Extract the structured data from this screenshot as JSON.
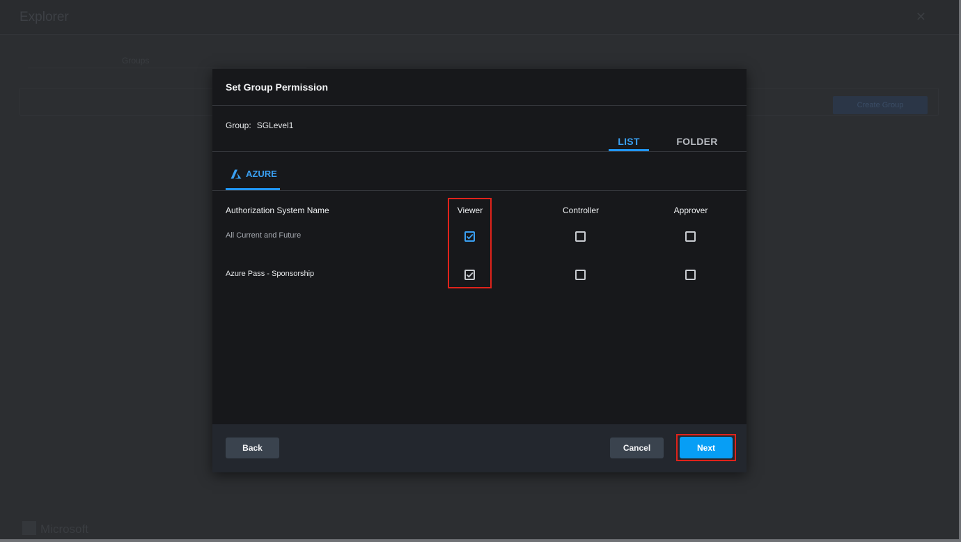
{
  "background": {
    "app_title": "Explorer",
    "tab_label": "Groups",
    "action_button": "Create Group",
    "footer_logo": "Microsoft"
  },
  "modal": {
    "title": "Set Group Permission",
    "group_label": "Group:",
    "group_value": "SGLevel1",
    "view_tabs": [
      {
        "label": "LIST",
        "active": true
      },
      {
        "label": "FOLDER",
        "active": false
      }
    ],
    "provider_tab": {
      "label": "AZURE",
      "icon": "azure-icon",
      "active": true
    },
    "table": {
      "columns": [
        "Authorization System Name",
        "Viewer",
        "Controller",
        "Approver"
      ],
      "rows": [
        {
          "name": "All Current and Future",
          "viewer": true,
          "controller": false,
          "approver": false
        },
        {
          "name": "Azure Pass - Sponsorship",
          "viewer": true,
          "controller": false,
          "approver": false
        }
      ]
    },
    "footer": {
      "back_label": "Back",
      "cancel_label": "Cancel",
      "next_label": "Next"
    }
  },
  "colors": {
    "accent": "#2196f3",
    "primary_button": "#079ef5",
    "highlight_box": "#e0231b",
    "modal_bg": "#17181b",
    "footer_bg": "#23272e"
  }
}
